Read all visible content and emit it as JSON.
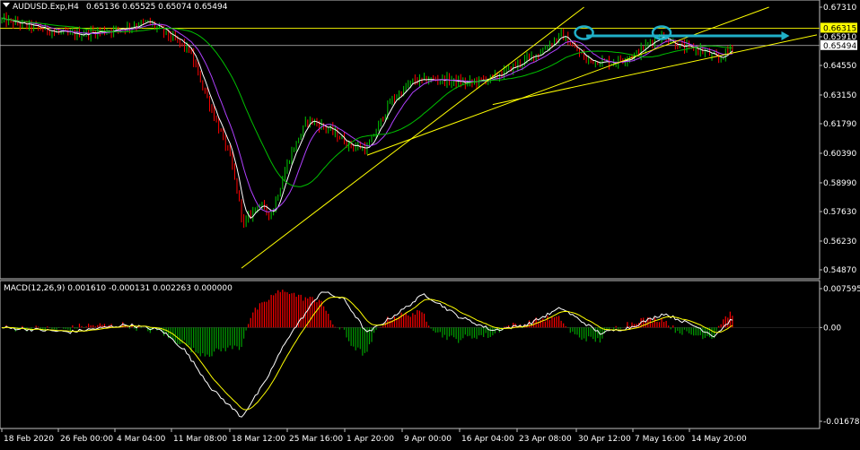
{
  "header": {
    "title": "AUDUSD.Exp,H4",
    "ohlc": "0.65136 0.65525 0.65074 0.65494"
  },
  "macd": {
    "label": "MACD(12,26,9) 0.001610 -0.000131 0.002263 0.000000"
  },
  "colors": {
    "background": "#000000",
    "frame": "#c0c0c0",
    "bull": "#00c800",
    "bear": "#ff0000",
    "ma_fast": "#ffffff",
    "ma_mid": "#b040ff",
    "ma_slow": "#00c000",
    "trendline": "#ffff00",
    "annotation": "#20b0c8",
    "macd_line": "#ffffff",
    "signal_line": "#ffff00",
    "hist_pos": "#ff0000",
    "hist_neg": "#00a000",
    "price_hl": "#ffff00",
    "price_cur": "#ffffff"
  },
  "chart_data": [
    {
      "type": "candlestick",
      "symbol": "AUDUSD.Exp",
      "timeframe": "H4",
      "ylim": [
        0.5487,
        0.6731
      ],
      "y_ticks": [
        "0.67310",
        "0.65910",
        "0.64550",
        "0.63150",
        "0.61790",
        "0.60390",
        "0.58990",
        "0.57630",
        "0.56230",
        "0.54870"
      ],
      "price_labels": [
        {
          "text": "0.66315",
          "value": 0.66315,
          "style": "highlight"
        },
        {
          "text": "0.65494",
          "value": 0.65494,
          "style": "current"
        }
      ],
      "horizontal_levels": [
        0.66315,
        0.65494
      ],
      "x_ticks": [
        "18 Feb 2020",
        "26 Feb 00:00",
        "4 Mar 04:00",
        "11 Mar 08:00",
        "18 Mar 12:00",
        "25 Mar 16:00",
        "1 Apr 20:00",
        "9 Apr 00:00",
        "16 Apr 04:00",
        "23 Apr 08:00",
        "30 Apr 12:00",
        "7 May 16:00",
        "14 May 20:00"
      ],
      "key_points": [
        {
          "t": 0,
          "p": 0.667
        },
        {
          "t": 30,
          "p": 0.66
        },
        {
          "t": 50,
          "p": 0.6625
        },
        {
          "t": 64,
          "p": 0.666
        },
        {
          "t": 70,
          "p": 0.662
        },
        {
          "t": 82,
          "p": 0.653
        },
        {
          "t": 90,
          "p": 0.63
        },
        {
          "t": 100,
          "p": 0.602
        },
        {
          "t": 106,
          "p": 0.57
        },
        {
          "t": 112,
          "p": 0.58
        },
        {
          "t": 118,
          "p": 0.575
        },
        {
          "t": 126,
          "p": 0.602
        },
        {
          "t": 134,
          "p": 0.62
        },
        {
          "t": 144,
          "p": 0.615
        },
        {
          "t": 152,
          "p": 0.608
        },
        {
          "t": 160,
          "p": 0.606
        },
        {
          "t": 170,
          "p": 0.628
        },
        {
          "t": 180,
          "p": 0.638
        },
        {
          "t": 192,
          "p": 0.639
        },
        {
          "t": 204,
          "p": 0.637
        },
        {
          "t": 216,
          "p": 0.64
        },
        {
          "t": 226,
          "p": 0.646
        },
        {
          "t": 236,
          "p": 0.652
        },
        {
          "t": 245,
          "p": 0.66
        },
        {
          "t": 256,
          "p": 0.648
        },
        {
          "t": 268,
          "p": 0.647
        },
        {
          "t": 278,
          "p": 0.651
        },
        {
          "t": 288,
          "p": 0.66
        },
        {
          "t": 298,
          "p": 0.654
        },
        {
          "t": 306,
          "p": 0.653
        },
        {
          "t": 314,
          "p": 0.648
        },
        {
          "t": 320,
          "p": 0.6549
        }
      ],
      "trendlines": [
        {
          "from": [
            105,
            0.5495
          ],
          "to": [
            255,
            0.6731
          ]
        },
        {
          "from": [
            160,
            0.603
          ],
          "to": [
            336,
            0.6731
          ]
        },
        {
          "from": [
            215,
            0.627
          ],
          "to": [
            357,
            0.66
          ]
        }
      ],
      "arrow": {
        "from": [
          256,
          0.6595
        ],
        "to": [
          345,
          0.6595
        ]
      },
      "circles": [
        {
          "t": 255,
          "p": 0.661
        },
        {
          "t": 289,
          "p": 0.661
        }
      ]
    },
    {
      "type": "macd",
      "params": "12,26,9",
      "ylim": [
        -0.016785,
        0.007595
      ],
      "y_ticks": [
        "0.007595",
        "0.00",
        "-0.016785"
      ],
      "macd_points": [
        {
          "t": 0,
          "v": 0.0
        },
        {
          "t": 30,
          "v": -0.0008
        },
        {
          "t": 55,
          "v": 0.0005
        },
        {
          "t": 70,
          "v": -0.0005
        },
        {
          "t": 80,
          "v": -0.004
        },
        {
          "t": 92,
          "v": -0.011
        },
        {
          "t": 105,
          "v": -0.016
        },
        {
          "t": 115,
          "v": -0.01
        },
        {
          "t": 125,
          "v": -0.002
        },
        {
          "t": 140,
          "v": 0.0065
        },
        {
          "t": 150,
          "v": 0.005
        },
        {
          "t": 160,
          "v": -0.001
        },
        {
          "t": 175,
          "v": 0.003
        },
        {
          "t": 185,
          "v": 0.006
        },
        {
          "t": 200,
          "v": 0.002
        },
        {
          "t": 215,
          "v": -0.0005
        },
        {
          "t": 230,
          "v": 0.0005
        },
        {
          "t": 245,
          "v": 0.0035
        },
        {
          "t": 262,
          "v": -0.001
        },
        {
          "t": 275,
          "v": 0.0
        },
        {
          "t": 290,
          "v": 0.0025
        },
        {
          "t": 305,
          "v": 0.0
        },
        {
          "t": 312,
          "v": -0.0015
        },
        {
          "t": 320,
          "v": 0.0016
        }
      ]
    }
  ]
}
